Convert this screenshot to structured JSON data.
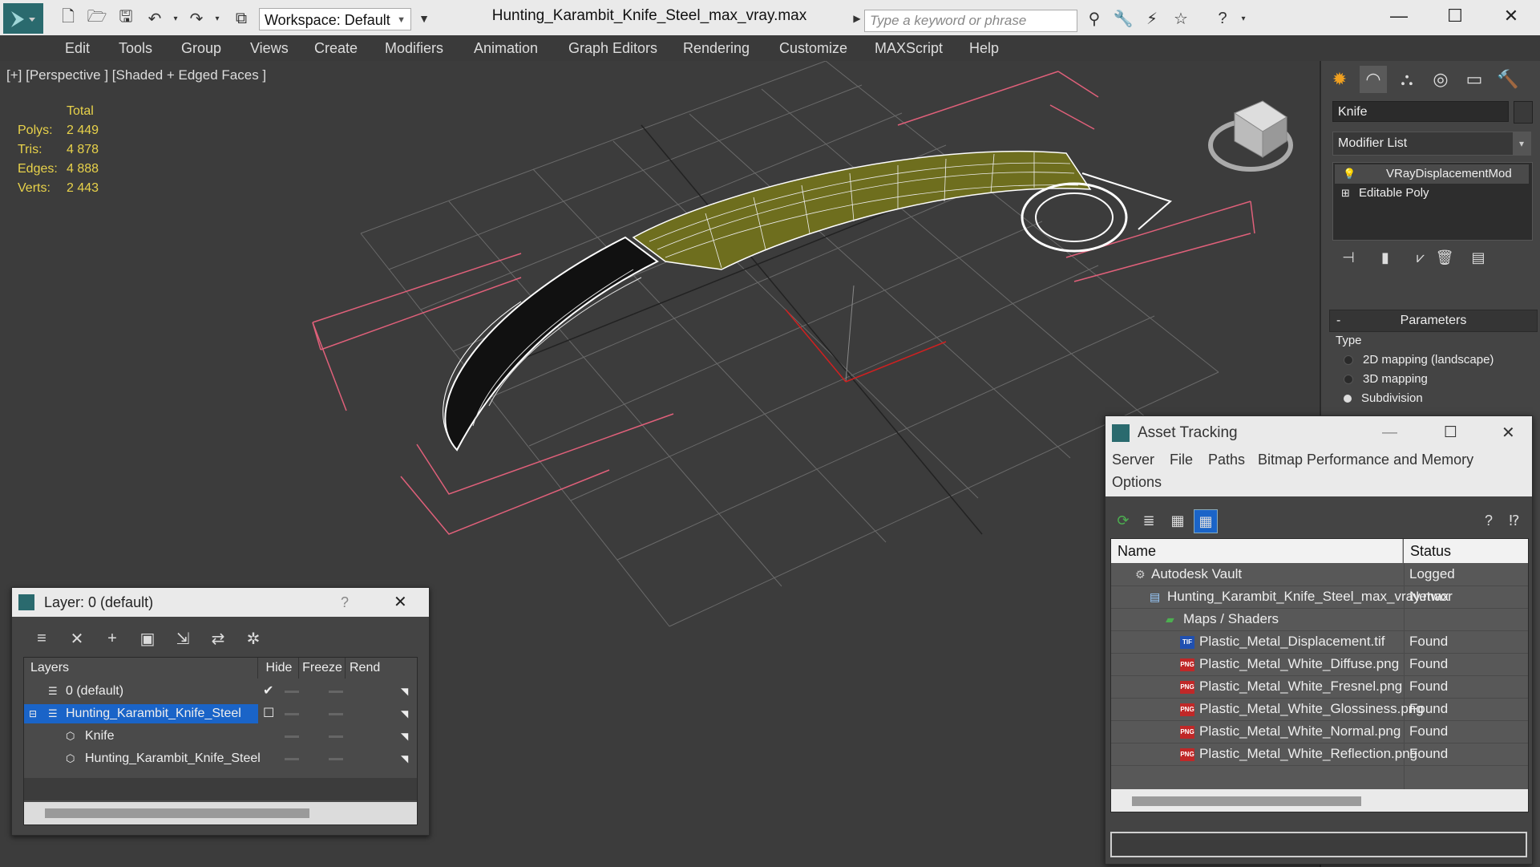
{
  "app": {
    "file_title": "Hunting_Karambit_Knife_Steel_max_vray.max",
    "workspace_label": "Workspace: Default",
    "search_placeholder": "Type a keyword or phrase"
  },
  "menu": [
    "Edit",
    "Tools",
    "Group",
    "Views",
    "Create",
    "Modifiers",
    "Animation",
    "Graph Editors",
    "Rendering",
    "Customize",
    "MAXScript",
    "Help"
  ],
  "viewport": {
    "label": "[+] [Perspective ] [Shaded + Edged Faces ]",
    "stats_header": "Total",
    "stats": [
      {
        "label": "Polys:",
        "value": "2 449"
      },
      {
        "label": "Tris:",
        "value": "4 878"
      },
      {
        "label": "Edges:",
        "value": "4 888"
      },
      {
        "label": "Verts:",
        "value": "2 443"
      }
    ]
  },
  "command_panel": {
    "object_name": "Knife",
    "modifier_list_label": "Modifier List",
    "stack": [
      "VRayDisplacementMod",
      "Editable Poly"
    ],
    "rollout_title": "Parameters",
    "rollout_collapse": "-",
    "type_label": "Type",
    "type_options": [
      {
        "label": "2D mapping (landscape)",
        "selected": false
      },
      {
        "label": "3D mapping",
        "selected": false
      },
      {
        "label": "Subdivision",
        "selected": true
      }
    ]
  },
  "layer_dialog": {
    "title": "Layer: 0 (default)",
    "help": "?",
    "columns": [
      "Layers",
      "Hide",
      "Freeze",
      "Rend"
    ],
    "rows": [
      {
        "name": "0 (default)",
        "active": true,
        "selected": false,
        "indent": 1
      },
      {
        "name": "Hunting_Karambit_Knife_Steel",
        "active": false,
        "selected": true,
        "indent": 1
      },
      {
        "name": "Knife",
        "active": false,
        "selected": false,
        "indent": 2
      },
      {
        "name": "Hunting_Karambit_Knife_Steel",
        "active": false,
        "selected": false,
        "indent": 2
      }
    ]
  },
  "asset_tracking": {
    "title": "Asset Tracking",
    "menu": [
      "Server",
      "File",
      "Paths",
      "Bitmap Performance and Memory",
      "Options"
    ],
    "columns": [
      "Name",
      "Status"
    ],
    "rows": [
      {
        "name": "Autodesk Vault",
        "status": "Logged",
        "level": 1,
        "icon": "vault"
      },
      {
        "name": "Hunting_Karambit_Knife_Steel_max_vray.max",
        "status": "Networ",
        "level": 2,
        "icon": "max"
      },
      {
        "name": "Maps / Shaders",
        "status": "",
        "level": 3,
        "icon": "maps"
      },
      {
        "name": "Plastic_Metal_Displacement.tif",
        "status": "Found",
        "level": 4,
        "icon": "TIF"
      },
      {
        "name": "Plastic_Metal_White_Diffuse.png",
        "status": "Found",
        "level": 4,
        "icon": "PNG"
      },
      {
        "name": "Plastic_Metal_White_Fresnel.png",
        "status": "Found",
        "level": 4,
        "icon": "PNG"
      },
      {
        "name": "Plastic_Metal_White_Glossiness.png",
        "status": "Found",
        "level": 4,
        "icon": "PNG"
      },
      {
        "name": "Plastic_Metal_White_Normal.png",
        "status": "Found",
        "level": 4,
        "icon": "PNG"
      },
      {
        "name": "Plastic_Metal_White_Reflection.png",
        "status": "Found",
        "level": 4,
        "icon": "PNG"
      }
    ]
  },
  "colors": {
    "accent_selection": "#1a64c8",
    "stats_yellow": "#e8d24a",
    "wire_green": "#6e6e1e",
    "bbox_pink": "#e0607a"
  }
}
